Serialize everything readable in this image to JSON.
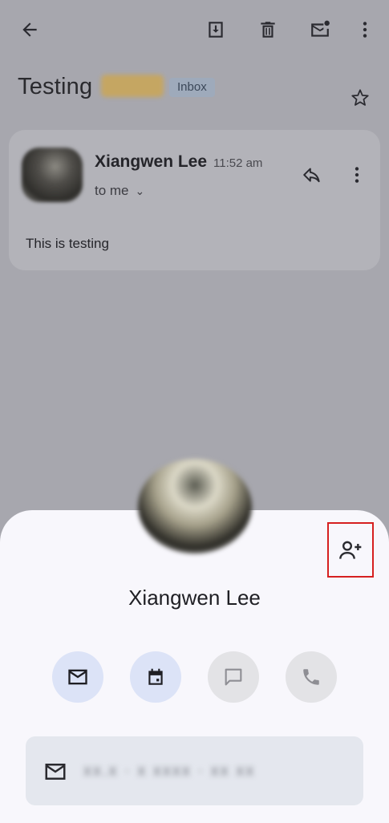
{
  "email": {
    "subject": "Testing",
    "label": "Inbox",
    "sender_name": "Xiangwen Lee",
    "time": "11:52 am",
    "to": "to me",
    "body": "This is testing"
  },
  "contact_card": {
    "name": "Xiangwen Lee",
    "email_masked": "xx.x · x  xxxx · xx xx"
  },
  "icons": {
    "back": "arrow-left-icon",
    "archive": "archive-icon",
    "delete": "trash-icon",
    "unread": "mark-unread-icon",
    "more": "more-vert-icon",
    "star": "star-outline-icon",
    "reply": "reply-icon",
    "add_contact": "person-add-icon",
    "mail": "mail-icon",
    "calendar": "calendar-icon",
    "chat": "chat-icon",
    "phone": "phone-icon"
  },
  "colors": {
    "scrim": "#a7a7ae",
    "sheet": "#f8f7fc",
    "accent_button": "#dce3f7",
    "highlight_box": "#d62020"
  }
}
